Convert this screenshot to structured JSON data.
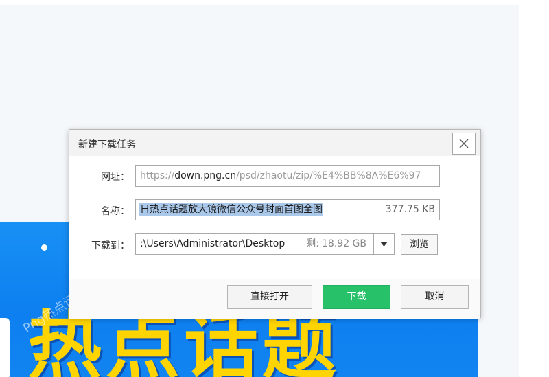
{
  "background": {
    "banner_headline": "热点话题",
    "banner_watermark": "Png热点话题"
  },
  "dialog": {
    "title": "新建下载任务",
    "url": {
      "label": "网址：",
      "prefix": "https://",
      "host": "down.png.cn",
      "path": "/psd/zhaotu/zip/%E4%BB%8A%E6%97"
    },
    "name": {
      "label": "名称：",
      "value": "日热点话题放大镜微信公众号封面首图全图",
      "size": "377.75 KB"
    },
    "save_to": {
      "label": "下载到：",
      "path": ":\\Users\\Administrator\\Desktop",
      "free_label": "剩:",
      "free_value": "18.92 GB",
      "browse_label": "浏览"
    },
    "buttons": {
      "open_directly": "直接打开",
      "download": "下载",
      "cancel": "取消"
    }
  },
  "colors": {
    "accent_green": "#27c16a",
    "banner_blue": "#1890f5",
    "headline_yellow": "#ffd400",
    "selection": "#aac8ea"
  }
}
